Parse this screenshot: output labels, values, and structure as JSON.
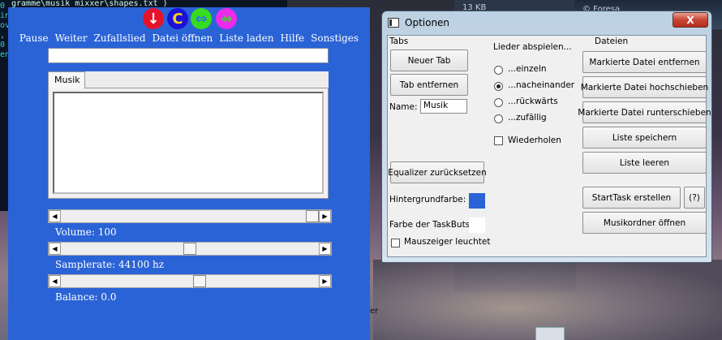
{
  "background": {
    "terminal_lines": [
      "",
      "0",
      "",
      "",
      "",
      "in",
      "ov",
      ", E",
      "",
      "0",
      "",
      "",
      "en"
    ],
    "terminal_cmdline": "gramme\\musik mixxer\\shapes.txt )",
    "explorer_label": "13 KB",
    "right_window_label": "© Foresa",
    "snippet": "er"
  },
  "music_player": {
    "circle_buttons": [
      {
        "name": "down-arrow-icon",
        "glyph": "↓",
        "color": "#e5132a",
        "fg": "#ffffff"
      },
      {
        "name": "c-icon",
        "glyph": "C",
        "color": "#1a12d8",
        "fg": "#ffd21a"
      },
      {
        "name": "left-right-arrow-icon",
        "glyph": "⇔",
        "color": "#38dc1e",
        "fg": "#2f7ad8"
      },
      {
        "name": "collapse-arrows-icon",
        "glyph": "⇸",
        "color": "#ee2aec",
        "fg": "#4acc2c"
      }
    ],
    "menu": [
      "Pause",
      "Weiter",
      "Zufallslied",
      "Datei öffnen",
      "Liste laden",
      "Hilfe",
      "Sonstiges"
    ],
    "search_value": "",
    "tab_label": "Musik",
    "songs": [],
    "sliders": [
      {
        "label": "Volume: 100",
        "position": 1.0
      },
      {
        "label": "Samplerate: 44100 hz",
        "position": 0.5
      },
      {
        "label": "Balance: 0.0",
        "position": 0.54
      }
    ],
    "colors": {
      "window_bg": "#2a63d6"
    }
  },
  "options": {
    "title": "Optionen",
    "close_glyph": "X",
    "tabs_section": {
      "heading": "Tabs",
      "new_tab": "Neuer Tab",
      "remove_tab": "Tab entfernen",
      "name_label": "Name:",
      "name_value": "Musik"
    },
    "play_section": {
      "heading": "Lieder abspielen...",
      "modes": [
        {
          "label": "...einzeln",
          "checked": false
        },
        {
          "label": "...nacheinander",
          "checked": true
        },
        {
          "label": "...rückwärts",
          "checked": false
        },
        {
          "label": "...zufällig",
          "checked": false
        }
      ],
      "repeat_label": "Wiederholen",
      "repeat_checked": false
    },
    "files_section": {
      "heading": "Dateien",
      "buttons": [
        "Markierte Datei entfernen",
        "Markierte Datei hochschieben",
        "Markierte Datei runterschieben",
        "Liste speichern",
        "Liste leeren"
      ],
      "starttask": "StartTask erstellen",
      "help": "(?)",
      "open_folder": "Musikordner öffnen"
    },
    "eq_reset": "Equalizer zurücksetzen",
    "bg_color_label": "Hintergrundfarbe:",
    "bg_color": "#2a63d6",
    "taskbut_color_label": "Farbe der TaskButs:",
    "taskbut_color": "#ffffff",
    "mouse_glow_label": "Mauszeiger leuchtet",
    "mouse_glow_checked": false
  }
}
